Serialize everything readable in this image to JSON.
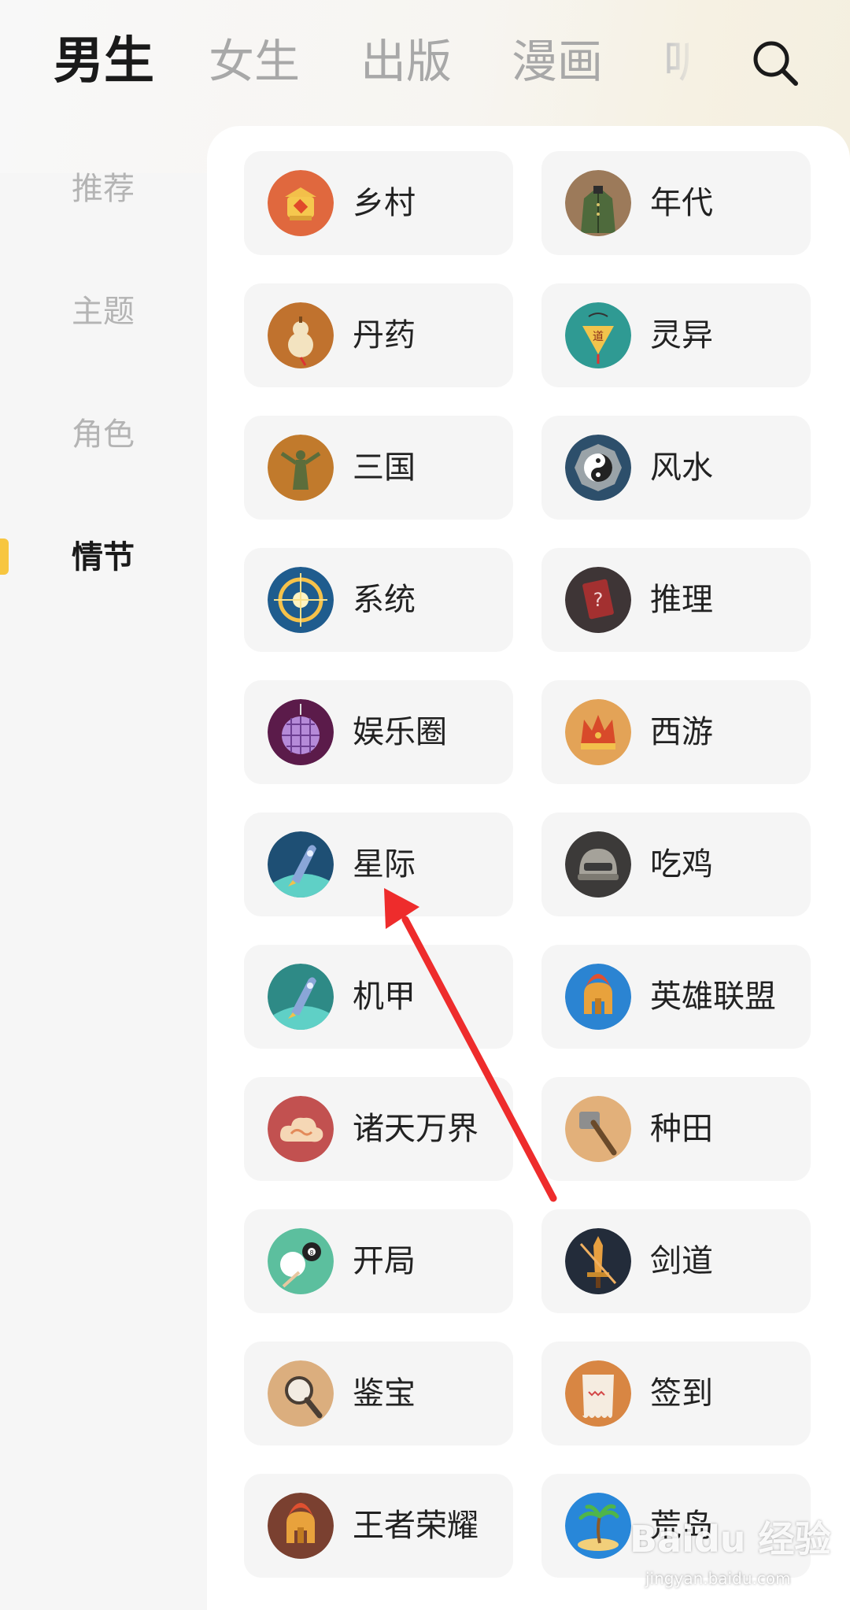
{
  "top_tabs": [
    "男生",
    "女生",
    "出版",
    "漫画",
    "听"
  ],
  "side_menu": [
    "推荐",
    "主题",
    "角色",
    "情节"
  ],
  "categories": [
    {
      "label": "乡村",
      "icon": "lantern-icon",
      "color": "#e0683e"
    },
    {
      "label": "年代",
      "icon": "army-coat-icon",
      "color": "#9c7a5a"
    },
    {
      "label": "丹药",
      "icon": "gourd-icon",
      "color": "#c0722e"
    },
    {
      "label": "灵异",
      "icon": "talisman-icon",
      "color": "#2f9a93"
    },
    {
      "label": "三国",
      "icon": "warrior-statue-icon",
      "color": "#c17a2c"
    },
    {
      "label": "风水",
      "icon": "bagua-compass-icon",
      "color": "#2d4f6b"
    },
    {
      "label": "系统",
      "icon": "crosshair-ring-icon",
      "color": "#1f5c8e"
    },
    {
      "label": "推理",
      "icon": "question-card-icon",
      "color": "#3e3536"
    },
    {
      "label": "娱乐圈",
      "icon": "disco-ball-icon",
      "color": "#5b1b4a"
    },
    {
      "label": "西游",
      "icon": "golden-crown-icon",
      "color": "#e3a357"
    },
    {
      "label": "星际",
      "icon": "rocket-icon",
      "color": "#1e4f74"
    },
    {
      "label": "吃鸡",
      "icon": "helmet-icon",
      "color": "#3c3a39"
    },
    {
      "label": "机甲",
      "icon": "rocket-icon",
      "color": "#2e8a86"
    },
    {
      "label": "英雄联盟",
      "icon": "spartan-helmet-icon",
      "color": "#2b84d2"
    },
    {
      "label": "诸天万界",
      "icon": "cloud-swirl-icon",
      "color": "#c25150"
    },
    {
      "label": "种田",
      "icon": "hoe-icon",
      "color": "#e2b07a"
    },
    {
      "label": "开局",
      "icon": "billiard-ball-icon",
      "color": "#5cbf9e"
    },
    {
      "label": "剑道",
      "icon": "sword-icon",
      "color": "#232c3a"
    },
    {
      "label": "鉴宝",
      "icon": "magnifier-icon",
      "color": "#dbae7e"
    },
    {
      "label": "签到",
      "icon": "scroll-icon",
      "color": "#d88643"
    },
    {
      "label": "王者荣耀",
      "icon": "spartan-helmet-icon",
      "color": "#7a4030"
    },
    {
      "label": "荒岛",
      "icon": "palm-island-icon",
      "color": "#2887d9"
    }
  ],
  "watermark": {
    "brand": "Baidu 经验",
    "url": "jingyan.baidu.com"
  },
  "annotation_color": "#ee2c2c"
}
